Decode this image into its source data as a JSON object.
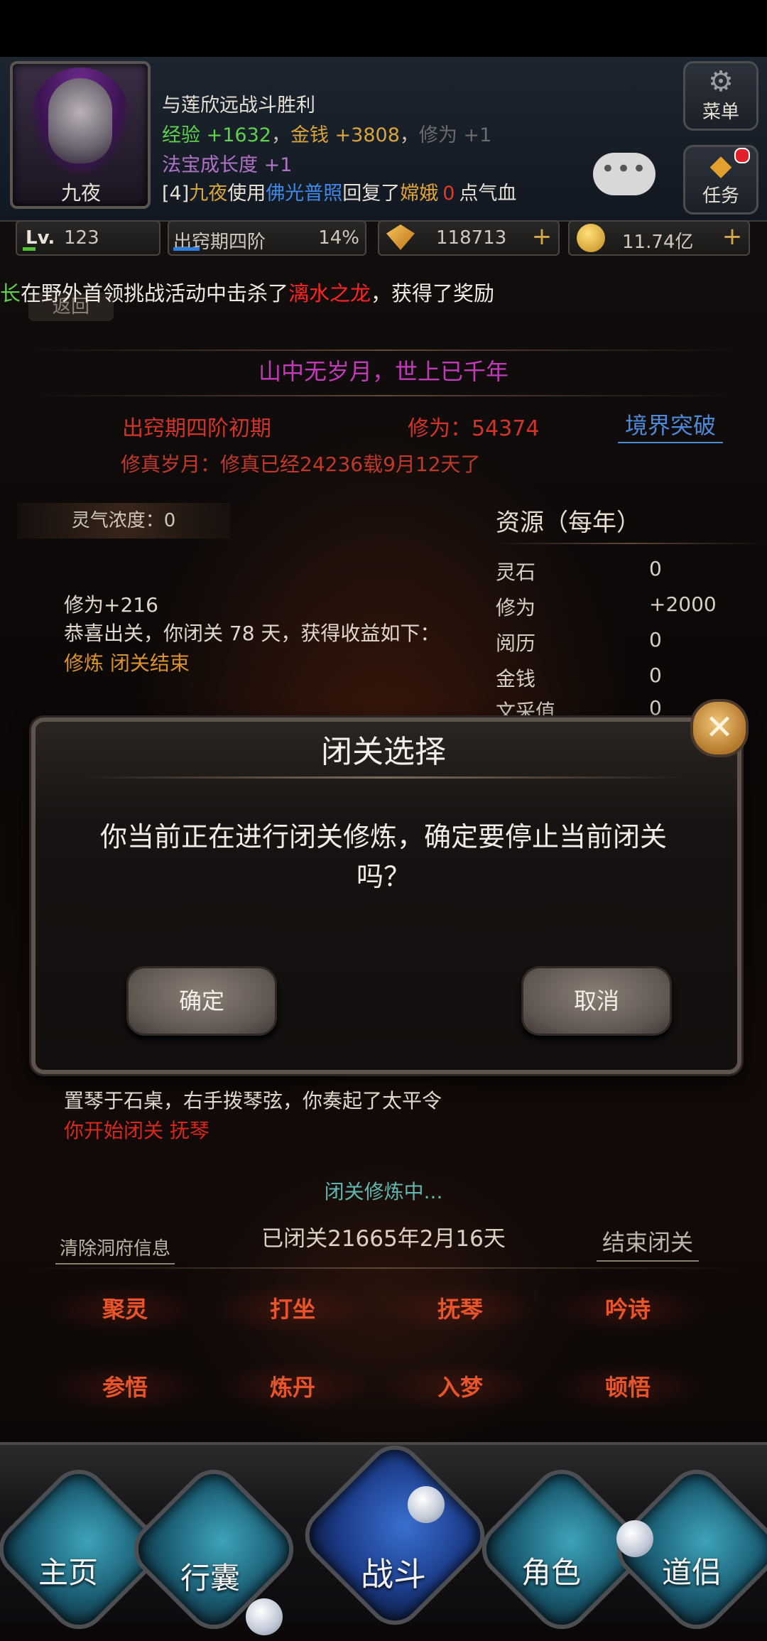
{
  "header": {
    "player_name": "九夜",
    "messages": {
      "battle": "与莲欣远战斗胜利",
      "exp_label": "经验",
      "exp_gain": "+1632",
      "money_label": "金钱",
      "money_gain": "+3808",
      "xiuwei_label": "修为",
      "xiuwei_gain": "+1",
      "treasure_growth": "法宝成长度 +1",
      "heal_prefix": "[4]",
      "heal_actor": "九夜",
      "heal_verb": "使用",
      "heal_skill": "佛光普照",
      "heal_mid": "回复了",
      "heal_target": "嫦娥",
      "heal_amount": "0",
      "heal_suffix": "点气血"
    },
    "menu_label": "菜单",
    "task_label": "任务",
    "chat_icon": "•••",
    "level_label": "Lv.",
    "level": "123",
    "level_progress": 0.1,
    "realm_stage": "出窍期四阶",
    "realm_percent": "14%",
    "realm_progress": 0.14,
    "gems": "118713",
    "gold": "11.74亿"
  },
  "ticker": {
    "lead": "长",
    "text1": "在野外首领挑战活动中击杀了",
    "boss": "漓水之龙",
    "text2": "，获得了奖励",
    "hidden_back": "返回"
  },
  "cultivation": {
    "motto": "山中无岁月，世上已千年",
    "realm": "出窍期四阶初期",
    "xiuwei": "修为：54374",
    "breakthrough_button": "境界突破",
    "years": "修真岁月：修真已经24236载9月12天了",
    "aura": "灵气浓度：0"
  },
  "resources": {
    "title": "资源（每年）",
    "rows": [
      {
        "name": "灵石",
        "value": "0"
      },
      {
        "name": "修为",
        "value": "+2000"
      },
      {
        "name": "阅历",
        "value": "0"
      },
      {
        "name": "金钱",
        "value": "0"
      },
      {
        "name": "文采值",
        "value": "0"
      }
    ]
  },
  "log": {
    "line1": "修为+216",
    "line2": "恭喜出关，你闭关 78 天，获得收益如下：",
    "line3": "修炼 闭关结束",
    "line4": "置琴于石桌，右手拨琴弦，你奏起了太平令",
    "line5": "你开始闭关 抚琴"
  },
  "dialog": {
    "title": "闭关选择",
    "message": "你当前正在进行闭关修炼，确定要停止当前闭关吗？",
    "confirm": "确定",
    "cancel": "取消",
    "close_icon": "✕"
  },
  "retreat": {
    "status": "闭关修炼中...",
    "clear_button": "清除洞府信息",
    "closed_time": "已闭关21665年2月16天",
    "end_button": "结束闭关"
  },
  "actions": [
    "聚灵",
    "打坐",
    "抚琴",
    "吟诗",
    "参悟",
    "炼丹",
    "入梦",
    "顿悟"
  ],
  "nav": [
    "主页",
    "行囊",
    "战斗",
    "角色",
    "道侣"
  ],
  "colors": {
    "accent_red": "#d2342a",
    "action_red": "#e8552a",
    "motto_purple": "#c13ab8",
    "link_blue": "#4c8ad8",
    "status_teal": "#5fb7b0"
  }
}
